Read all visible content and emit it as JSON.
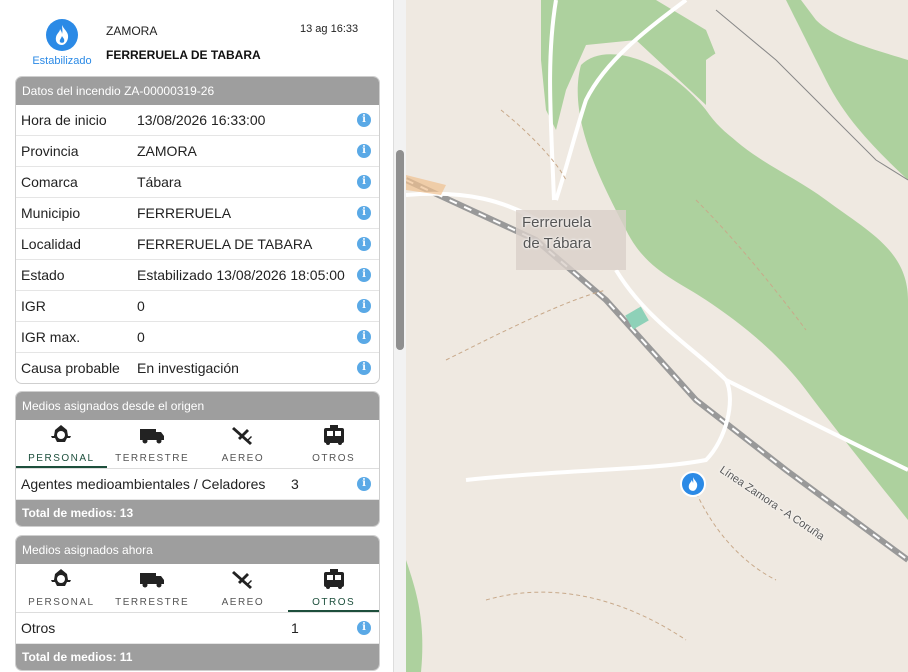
{
  "header": {
    "status_label": "Estabilizado",
    "province": "ZAMORA",
    "date": "13 ag 16:33",
    "municipality": "FERRERUELA DE TABARA"
  },
  "datos": {
    "title": "Datos del incendio ZA-00000319-26",
    "rows": [
      {
        "label": "Hora de inicio",
        "value": "13/08/2026 16:33:00"
      },
      {
        "label": "Provincia",
        "value": "ZAMORA"
      },
      {
        "label": "Comarca",
        "value": "Tábara"
      },
      {
        "label": "Municipio",
        "value": "FERRERUELA"
      },
      {
        "label": "Localidad",
        "value": "FERRERUELA DE TABARA"
      },
      {
        "label": "Estado",
        "value": "Estabilizado 13/08/2026 18:05:00"
      },
      {
        "label": "IGR",
        "value": "0"
      },
      {
        "label": "IGR max.",
        "value": "0"
      },
      {
        "label": "Causa probable",
        "value": "En investigación"
      }
    ]
  },
  "origen": {
    "title": "Medios asignados desde el origen",
    "tabs": [
      "PERSONAL",
      "TERRESTRE",
      "AEREO",
      "OTROS"
    ],
    "active_tab": "PERSONAL",
    "item_name": "Agentes medioambientales / Celadores",
    "item_count": "3",
    "total": "Total de medios: 13"
  },
  "ahora": {
    "title": "Medios asignados ahora",
    "tabs": [
      "PERSONAL",
      "TERRESTRE",
      "AEREO",
      "OTROS"
    ],
    "active_tab": "OTROS",
    "item_name": "Otros",
    "item_count": "1",
    "total": "Total de medios: 11"
  },
  "map": {
    "town_line1": "Ferreruela",
    "town_line2": "de Tábara",
    "rail_label": "Línea Zamora - A Coruña"
  },
  "info_glyph": "i",
  "colors": {
    "accent": "#2b8ae6",
    "header_gray": "#9e9e9e",
    "active_tab": "#1d4f3c",
    "forest": "#add19e"
  }
}
